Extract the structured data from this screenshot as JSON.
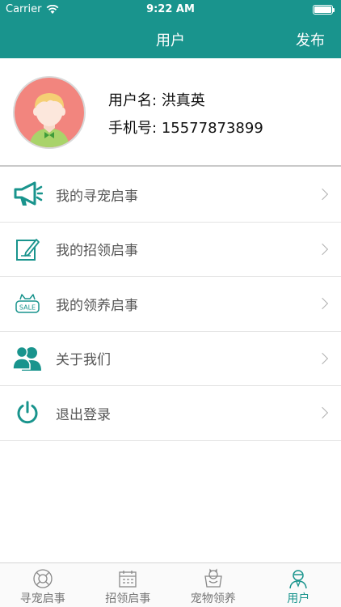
{
  "status_bar": {
    "carrier": "Carrier",
    "time": "9:22 AM"
  },
  "nav": {
    "title": "用户",
    "action": "发布"
  },
  "profile": {
    "username_label": "用户名:",
    "username": "洪真英",
    "phone_label": "手机号:",
    "phone": "15577873899"
  },
  "menu": [
    {
      "label": "我的寻宠启事",
      "icon": "megaphone-icon"
    },
    {
      "label": "我的招领启事",
      "icon": "edit-note-icon"
    },
    {
      "label": "我的领养启事",
      "icon": "sale-cat-icon"
    },
    {
      "label": "关于我们",
      "icon": "people-icon"
    },
    {
      "label": "退出登录",
      "icon": "power-icon"
    }
  ],
  "tabs": [
    {
      "label": "寻宠启事",
      "icon": "lifebuoy-icon"
    },
    {
      "label": "招领启事",
      "icon": "calendar-icon"
    },
    {
      "label": "宠物领养",
      "icon": "pet-box-icon"
    },
    {
      "label": "用户",
      "icon": "user-icon",
      "active": true
    }
  ],
  "colors": {
    "primary": "#19948d",
    "avatar_bg": "#f2857e",
    "separator": "#e3e3e3"
  }
}
